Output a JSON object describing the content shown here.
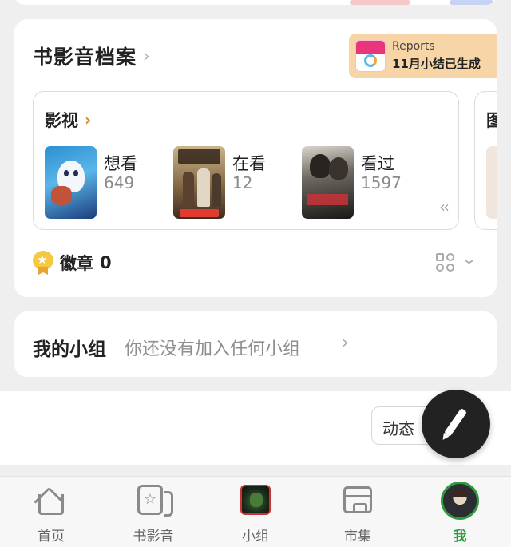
{
  "archive": {
    "title": "书影音档案",
    "reports": {
      "title": "Reports",
      "subtitle": "11月小结已生成"
    },
    "movies": {
      "title": "影视",
      "stats": [
        {
          "label": "想看",
          "count": "649"
        },
        {
          "label": "在看",
          "count": "12"
        },
        {
          "label": "看过",
          "count": "1597"
        }
      ]
    },
    "side_title": "图",
    "badges": {
      "label": "徽章",
      "count": "0"
    }
  },
  "groups": {
    "label": "我的小组",
    "empty_text": "你还没有加入任何小组"
  },
  "feed": {
    "dynamic_label": "动态"
  },
  "tabbar": {
    "tabs": [
      {
        "label": "首页",
        "icon": "home-icon"
      },
      {
        "label": "书影音",
        "icon": "book-star-icon"
      },
      {
        "label": "小组",
        "icon": "group-avatar-icon"
      },
      {
        "label": "市集",
        "icon": "market-icon"
      },
      {
        "label": "我",
        "icon": "profile-avatar-icon",
        "active": true
      }
    ],
    "active_color": "#2f9a3c"
  }
}
